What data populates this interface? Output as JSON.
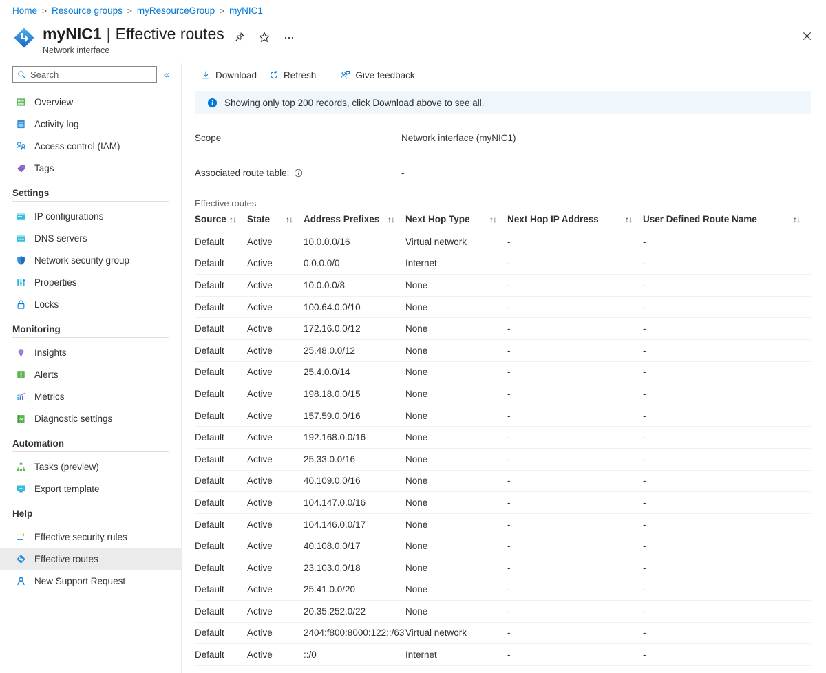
{
  "breadcrumb": [
    {
      "label": "Home"
    },
    {
      "label": "Resource groups"
    },
    {
      "label": "myResourceGroup"
    },
    {
      "label": "myNIC1"
    }
  ],
  "breadcrumb_separator": ">",
  "header": {
    "resource_name": "myNIC1",
    "separator": "|",
    "page_name": "Effective routes",
    "subtitle": "Network interface",
    "pin_icon": "pin-icon",
    "favorite_icon": "star-icon",
    "more_icon": "ellipsis-icon",
    "close_icon": "close-icon",
    "resource_icon": "network-interface-icon"
  },
  "sidebar": {
    "search": {
      "placeholder": "Search",
      "value": "",
      "icon": "search-icon"
    },
    "collapse_icon": "«",
    "items": [
      {
        "label": "Overview",
        "icon": "overview-icon",
        "group": null,
        "selected": false
      },
      {
        "label": "Activity log",
        "icon": "activity-log-icon",
        "group": null,
        "selected": false
      },
      {
        "label": "Access control (IAM)",
        "icon": "access-control-icon",
        "group": null,
        "selected": false
      },
      {
        "label": "Tags",
        "icon": "tags-icon",
        "group": null,
        "selected": false
      }
    ],
    "groups": [
      {
        "title": "Settings",
        "items": [
          {
            "label": "IP configurations",
            "icon": "ip-configurations-icon",
            "selected": false
          },
          {
            "label": "DNS servers",
            "icon": "dns-servers-icon",
            "selected": false
          },
          {
            "label": "Network security group",
            "icon": "shield-icon",
            "selected": false
          },
          {
            "label": "Properties",
            "icon": "properties-icon",
            "selected": false
          },
          {
            "label": "Locks",
            "icon": "lock-icon",
            "selected": false
          }
        ]
      },
      {
        "title": "Monitoring",
        "items": [
          {
            "label": "Insights",
            "icon": "insights-icon",
            "selected": false
          },
          {
            "label": "Alerts",
            "icon": "alerts-icon",
            "selected": false
          },
          {
            "label": "Metrics",
            "icon": "metrics-icon",
            "selected": false
          },
          {
            "label": "Diagnostic settings",
            "icon": "diagnostic-settings-icon",
            "selected": false
          }
        ]
      },
      {
        "title": "Automation",
        "items": [
          {
            "label": "Tasks (preview)",
            "icon": "tasks-icon",
            "selected": false
          },
          {
            "label": "Export template",
            "icon": "export-template-icon",
            "selected": false
          }
        ]
      },
      {
        "title": "Help",
        "items": [
          {
            "label": "Effective security rules",
            "icon": "effective-security-rules-icon",
            "selected": false
          },
          {
            "label": "Effective routes",
            "icon": "effective-routes-icon",
            "selected": true
          },
          {
            "label": "New Support Request",
            "icon": "support-request-icon",
            "selected": false
          }
        ]
      }
    ]
  },
  "toolbar": {
    "download_label": "Download",
    "download_icon": "download-icon",
    "refresh_label": "Refresh",
    "refresh_icon": "refresh-icon",
    "feedback_label": "Give feedback",
    "feedback_icon": "feedback-person-icon"
  },
  "info_bar": {
    "icon": "info-icon",
    "message": "Showing only top 200 records, click Download above to see all."
  },
  "details": {
    "scope_label": "Scope",
    "scope_value": "Network interface (myNIC1)",
    "route_table_label": "Associated route table:",
    "route_table_info_icon": "info-circle-icon",
    "route_table_value": "-"
  },
  "grid": {
    "caption": "Effective routes",
    "sort_icon": "↑↓",
    "columns": [
      "Source",
      "State",
      "Address Prefixes",
      "Next Hop Type",
      "Next Hop IP Address",
      "User Defined Route Name"
    ],
    "rows": [
      [
        "Default",
        "Active",
        "10.0.0.0/16",
        "Virtual network",
        "-",
        "-"
      ],
      [
        "Default",
        "Active",
        "0.0.0.0/0",
        "Internet",
        "-",
        "-"
      ],
      [
        "Default",
        "Active",
        "10.0.0.0/8",
        "None",
        "-",
        "-"
      ],
      [
        "Default",
        "Active",
        "100.64.0.0/10",
        "None",
        "-",
        "-"
      ],
      [
        "Default",
        "Active",
        "172.16.0.0/12",
        "None",
        "-",
        "-"
      ],
      [
        "Default",
        "Active",
        "25.48.0.0/12",
        "None",
        "-",
        "-"
      ],
      [
        "Default",
        "Active",
        "25.4.0.0/14",
        "None",
        "-",
        "-"
      ],
      [
        "Default",
        "Active",
        "198.18.0.0/15",
        "None",
        "-",
        "-"
      ],
      [
        "Default",
        "Active",
        "157.59.0.0/16",
        "None",
        "-",
        "-"
      ],
      [
        "Default",
        "Active",
        "192.168.0.0/16",
        "None",
        "-",
        "-"
      ],
      [
        "Default",
        "Active",
        "25.33.0.0/16",
        "None",
        "-",
        "-"
      ],
      [
        "Default",
        "Active",
        "40.109.0.0/16",
        "None",
        "-",
        "-"
      ],
      [
        "Default",
        "Active",
        "104.147.0.0/16",
        "None",
        "-",
        "-"
      ],
      [
        "Default",
        "Active",
        "104.146.0.0/17",
        "None",
        "-",
        "-"
      ],
      [
        "Default",
        "Active",
        "40.108.0.0/17",
        "None",
        "-",
        "-"
      ],
      [
        "Default",
        "Active",
        "23.103.0.0/18",
        "None",
        "-",
        "-"
      ],
      [
        "Default",
        "Active",
        "25.41.0.0/20",
        "None",
        "-",
        "-"
      ],
      [
        "Default",
        "Active",
        "20.35.252.0/22",
        "None",
        "-",
        "-"
      ],
      [
        "Default",
        "Active",
        "2404:f800:8000:122::/63",
        "Virtual network",
        "-",
        "-"
      ],
      [
        "Default",
        "Active",
        "::/0",
        "Internet",
        "-",
        "-"
      ]
    ]
  },
  "colors": {
    "accent": "#0078d4",
    "info_bg": "#eff6fc",
    "selected_bg": "#ebebeb",
    "text": "#323130"
  }
}
